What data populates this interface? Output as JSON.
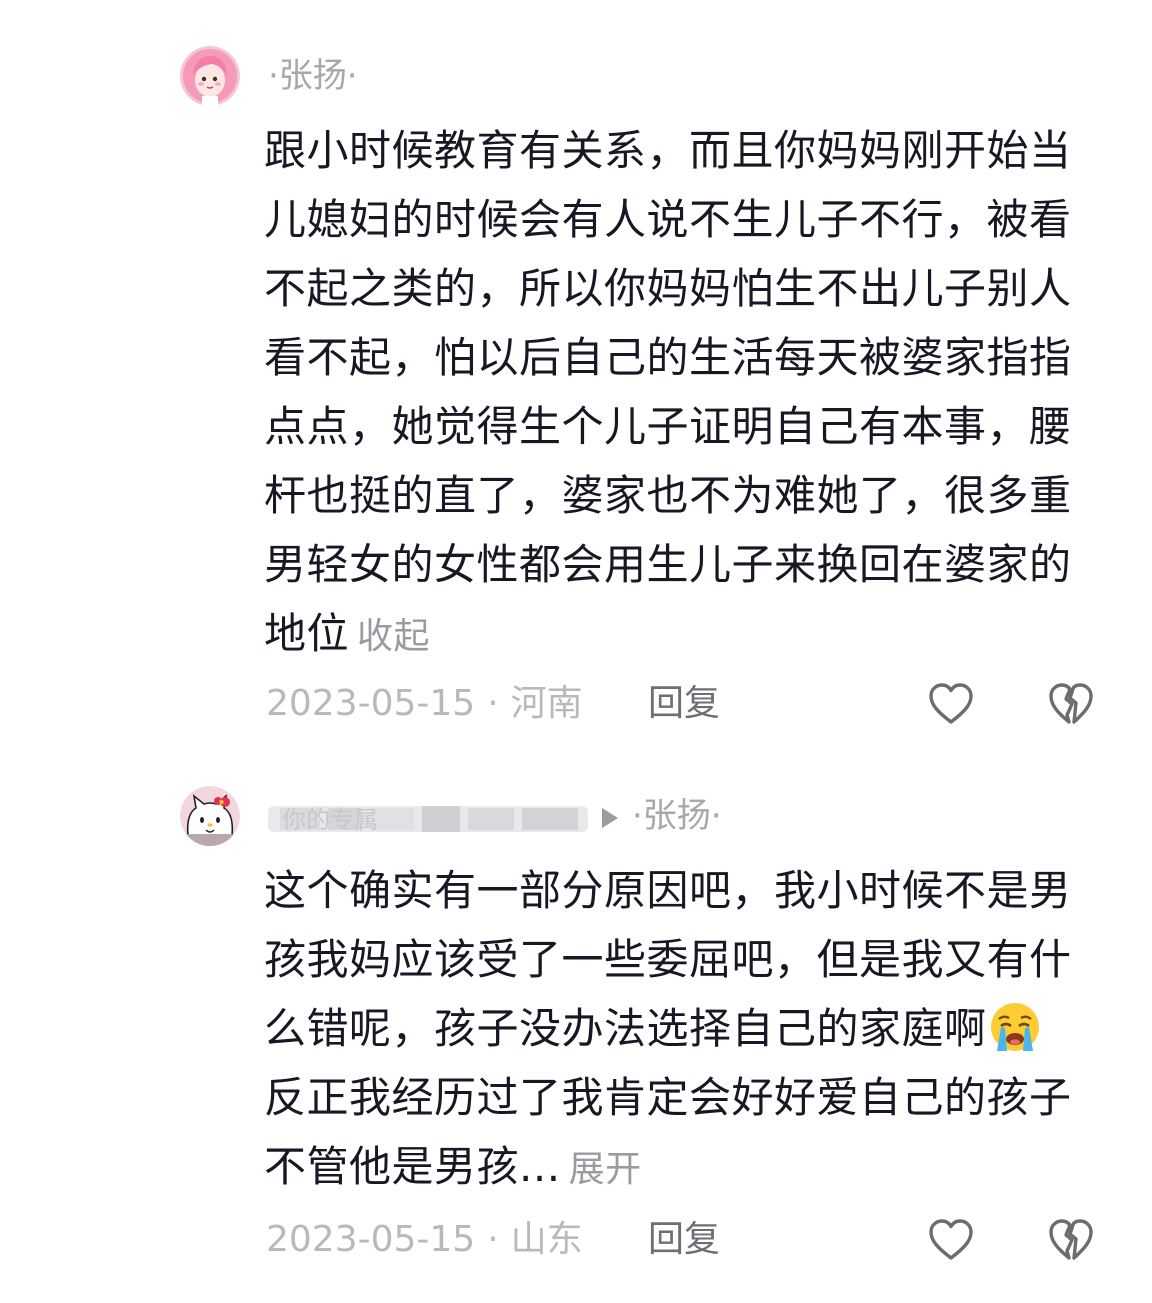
{
  "comments": [
    {
      "author": "·张扬·",
      "text": "跟小时候教育有关系，而且你妈妈刚开始当儿媳妇的时候会有人说不生儿子不行，被看不起之类的，所以你妈妈怕生不出儿子别人看不起，怕以后自己的生活每天被婆家指指点点，她觉得生个儿子证明自己有本事，腰杆也挺的直了，婆家也不为难她了，很多重男轻女的女性都会用生儿子来换回在婆家的地位",
      "toggle": "收起",
      "date": "2023-05-15",
      "separator": "·",
      "location": "河南",
      "reply": "回复",
      "avatar_icon": "pink-hair-girl-avatar"
    },
    {
      "author": "·张扬·",
      "author_redacted": "你的专属",
      "text_before_emoji": "这个确实有一部分原因吧，我小时候不是男孩我妈应该受了一些委屈吧，但是我又有什么错呢，孩子没办法选择自己的家庭啊",
      "emoji": "crying-face-emoji",
      "text_after_emoji": "反正我经历过了我肯定会好好爱自己的孩子不管他是男孩...",
      "toggle": "展开",
      "date": "2023-05-15",
      "separator": "·",
      "location": "山东",
      "reply": "回复",
      "avatar_icon": "hello-kitty-avatar"
    }
  ],
  "colors": {
    "text": "#161823",
    "muted": "#b8b9bd",
    "author": "#a7a8ad",
    "reply": "#6e6f74",
    "icon_stroke": "#6b6c70"
  }
}
